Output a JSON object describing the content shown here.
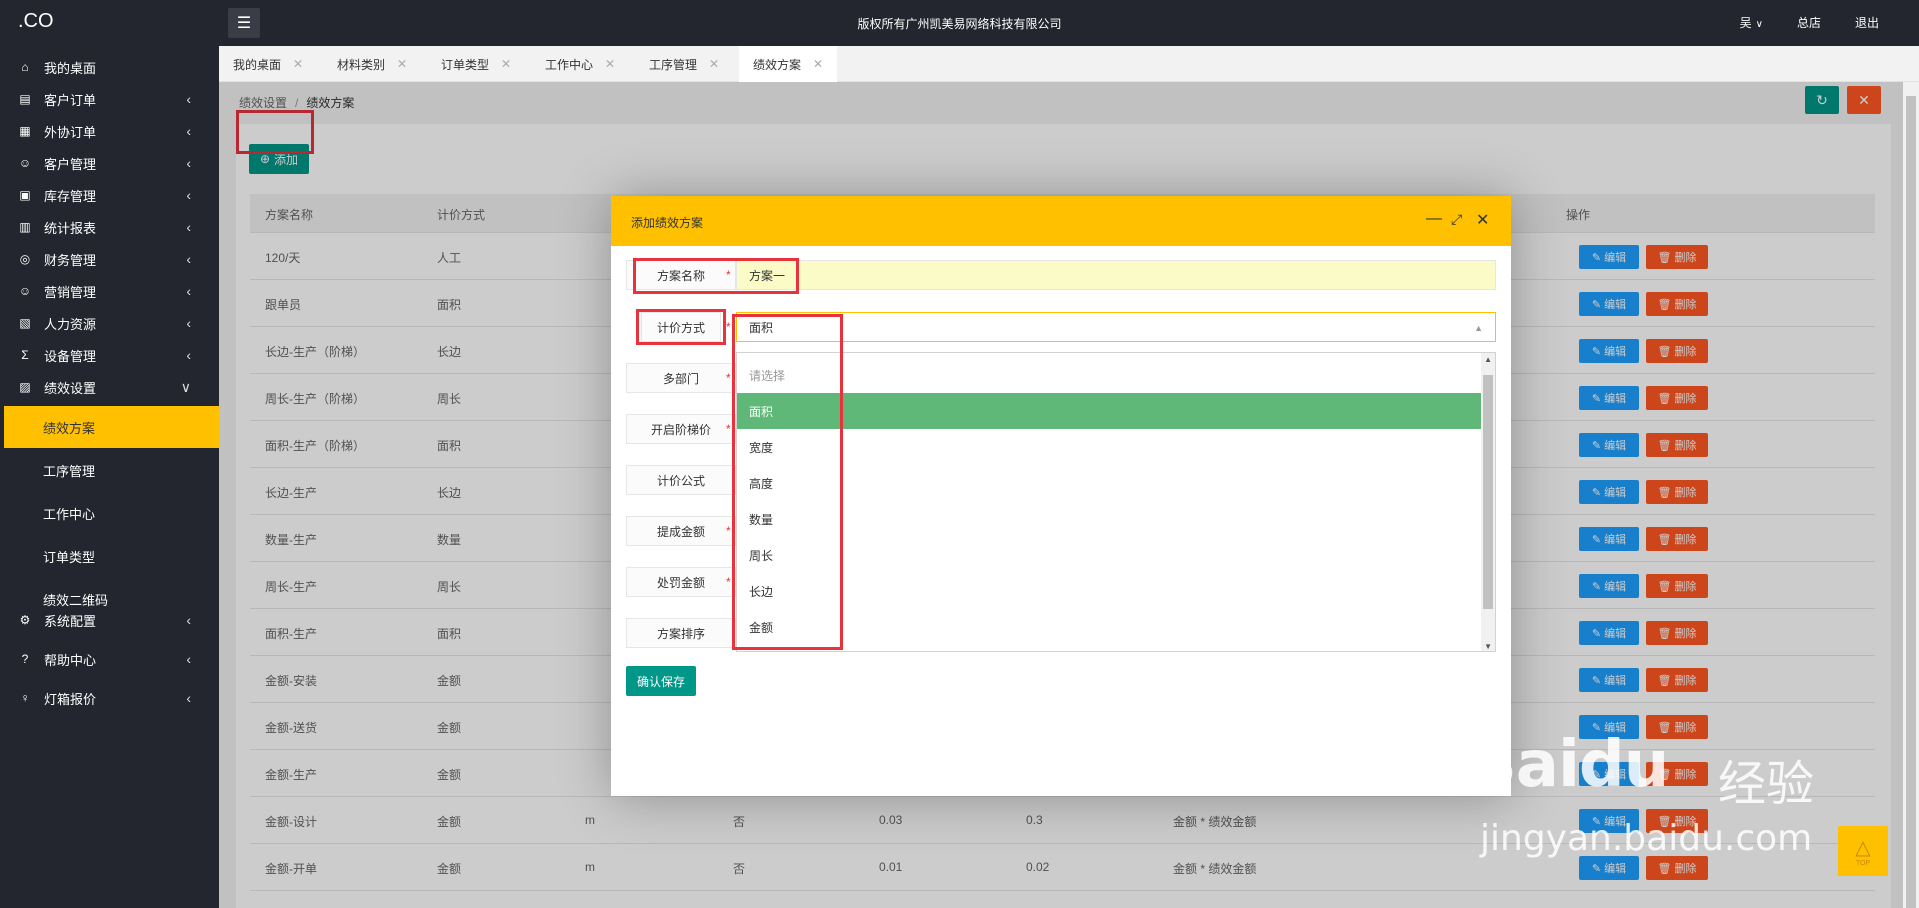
{
  "app": {
    "logo": ".CO",
    "copyright": "版权所有广州凯美易网络科技有限公司",
    "user": "吴",
    "store": "总店",
    "logout": "退出"
  },
  "sidebar": {
    "items": [
      {
        "label": "我的桌面",
        "icon": "home-icon",
        "glyph": "⌂"
      },
      {
        "label": "客户订单",
        "icon": "document-icon",
        "glyph": "▤"
      },
      {
        "label": "外协订单",
        "icon": "outsource-icon",
        "glyph": "▦"
      },
      {
        "label": "客户管理",
        "icon": "users-icon",
        "glyph": "☺"
      },
      {
        "label": "库存管理",
        "icon": "warehouse-icon",
        "glyph": "▣"
      },
      {
        "label": "统计报表",
        "icon": "chart-icon",
        "glyph": "▥"
      },
      {
        "label": "财务管理",
        "icon": "finance-icon",
        "glyph": "◎"
      },
      {
        "label": "营销管理",
        "icon": "marketing-icon",
        "glyph": "☺"
      },
      {
        "label": "人力资源",
        "icon": "hr-icon",
        "glyph": "▧"
      },
      {
        "label": "设备管理",
        "icon": "equipment-icon",
        "glyph": "Σ"
      },
      {
        "label": "绩效设置",
        "icon": "performance-icon",
        "glyph": "▨"
      }
    ],
    "sub_items": [
      "绩效方案",
      "工序管理",
      "工作中心",
      "订单类型",
      "绩效二维码"
    ],
    "bottom_items": [
      {
        "label": "系统配置",
        "icon": "gear-icon",
        "glyph": "⚙"
      },
      {
        "label": "帮助中心",
        "icon": "help-icon",
        "glyph": "?"
      },
      {
        "label": "灯箱报价",
        "icon": "lightbox-icon",
        "glyph": "♀"
      }
    ]
  },
  "tabs": [
    "我的桌面",
    "材料类别",
    "订单类型",
    "工作中心",
    "工序管理",
    "绩效方案"
  ],
  "breadcrumb": {
    "parent": "绩效设置",
    "current": "绩效方案"
  },
  "toolbar": {
    "add_label": "添加"
  },
  "table": {
    "headers": [
      "方案名称",
      "计价方式",
      "操作"
    ],
    "edit_label": "编辑",
    "delete_label": "删除",
    "rows": [
      {
        "name": "120/天",
        "method": "人工",
        "unit": "",
        "stepped": "",
        "commission": "",
        "penalty": "",
        "formula": ""
      },
      {
        "name": "跟单员",
        "method": "面积",
        "unit": "",
        "stepped": "",
        "commission": "",
        "penalty": "",
        "formula": ""
      },
      {
        "name": "长边-生产（阶梯）",
        "method": "长边",
        "unit": "",
        "stepped": "",
        "commission": "",
        "penalty": "",
        "formula": ""
      },
      {
        "name": "周长-生产（阶梯）",
        "method": "周长",
        "unit": "",
        "stepped": "",
        "commission": "",
        "penalty": "",
        "formula": ""
      },
      {
        "name": "面积-生产（阶梯）",
        "method": "面积",
        "unit": "",
        "stepped": "",
        "commission": "",
        "penalty": "",
        "formula": ""
      },
      {
        "name": "长边-生产",
        "method": "长边",
        "unit": "",
        "stepped": "",
        "commission": "",
        "penalty": "",
        "formula": ""
      },
      {
        "name": "数量-生产",
        "method": "数量",
        "unit": "",
        "stepped": "",
        "commission": "",
        "penalty": "",
        "formula": ""
      },
      {
        "name": "周长-生产",
        "method": "周长",
        "unit": "",
        "stepped": "",
        "commission": "",
        "penalty": "",
        "formula": ""
      },
      {
        "name": "面积-生产",
        "method": "面积",
        "unit": "",
        "stepped": "",
        "commission": "",
        "penalty": "",
        "formula": ""
      },
      {
        "name": "金额-安装",
        "method": "金额",
        "unit": "",
        "stepped": "",
        "commission": "",
        "penalty": "",
        "formula": ""
      },
      {
        "name": "金额-送货",
        "method": "金额",
        "unit": "",
        "stepped": "",
        "commission": "",
        "penalty": "",
        "formula": ""
      },
      {
        "name": "金额-生产",
        "method": "金额",
        "unit": "",
        "stepped": "",
        "commission": "",
        "penalty": "",
        "formula": ""
      },
      {
        "name": "金额-设计",
        "method": "金额",
        "unit": "m",
        "stepped": "否",
        "commission": "0.03",
        "penalty": "0.3",
        "formula": "金额 * 绩效金额"
      },
      {
        "name": "金额-开单",
        "method": "金额",
        "unit": "m",
        "stepped": "否",
        "commission": "0.01",
        "penalty": "0.02",
        "formula": "金额 * 绩效金额"
      }
    ]
  },
  "modal": {
    "title": "添加绩效方案",
    "fields": {
      "name_label": "方案名称",
      "name_value": "方案一",
      "method_label": "计价方式",
      "method_value": "面积",
      "dept_label": "多部门",
      "stepped_label": "开启阶梯价",
      "formula_label": "计价公式",
      "commission_label": "提成金额",
      "penalty_label": "处罚金额",
      "sort_label": "方案排序"
    },
    "dropdown": {
      "placeholder": "请选择",
      "options": [
        "面积",
        "宽度",
        "高度",
        "数量",
        "周长",
        "长边",
        "金额"
      ],
      "selected": "面积"
    },
    "save_label": "确认保存"
  },
  "watermark": {
    "logo": "Baidu",
    "cn": "经验",
    "url": "jingyan.baidu.com"
  },
  "top_button": "TOP",
  "colors": {
    "sidebar_bg": "#23262e",
    "accent_yellow": "#ffc000",
    "primary_green": "#009688",
    "selected_green": "#5fb878",
    "edit_blue": "#1e9fff",
    "delete_orange": "#ff5722",
    "highlight_red": "#e8323c"
  }
}
